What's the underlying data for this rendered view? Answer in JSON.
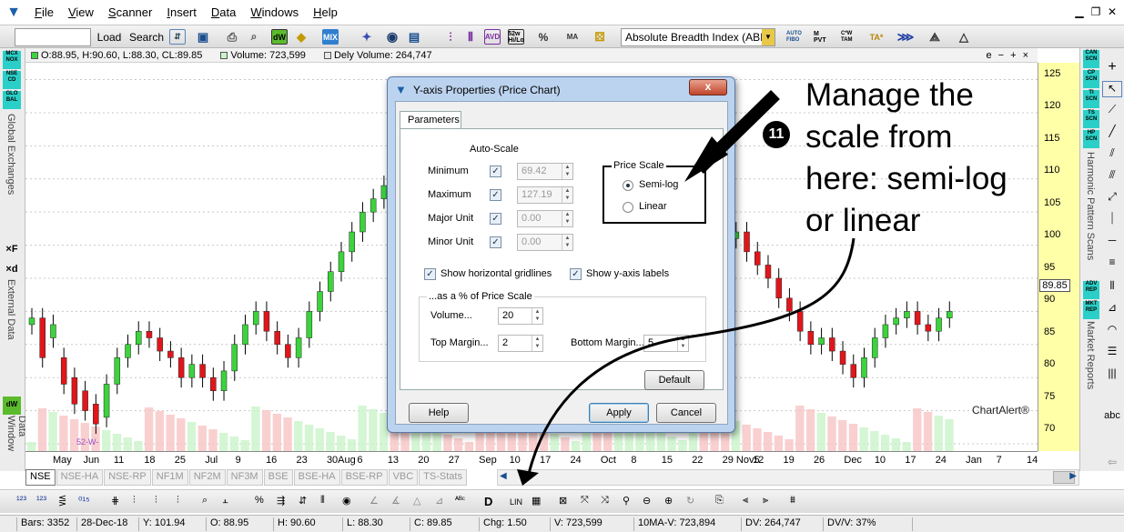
{
  "menu": {
    "items": [
      "File",
      "View",
      "Scanner",
      "Insert",
      "Data",
      "Windows",
      "Help"
    ]
  },
  "toolbar": {
    "load_label": "Load",
    "search_label": "Search",
    "indicator_value": "Absolute Breadth Index (ABI",
    "icon_labels": {
      "dw": "dW",
      "week52": "52w Hi/Lo",
      "mix": "MIX",
      "fibo": "AUTO FIBO",
      "mpvt": "M PVT",
      "tam": "C*W TAM",
      "ta": "TA*"
    }
  },
  "infobar": {
    "ohlc": "O:88.95, H:90.60, L:88.30, CL:89.85",
    "volume": "Volume: 723,599",
    "dely": "Dely Volume: 264,747",
    "corner": "e − + ×"
  },
  "left_panel": {
    "buttons": [
      "MCX NOX",
      "NSE CD",
      "GLO BAL"
    ],
    "global_label": "Global Exchanges",
    "xf_label": "×F",
    "xd_label": "×d",
    "external_label": "External Data",
    "dw": "dW",
    "data_window_label": "Data Window"
  },
  "right_panel": {
    "scan_buttons": [
      "CAN SCN",
      "CP SCN",
      "TI SCN",
      "TS SCN",
      "HP SCN"
    ],
    "harmonic_label": "Harmonic Pattern Scans",
    "report_buttons": [
      "ADV REP",
      "MKT REP"
    ],
    "market_reports_label": "Market Reports",
    "abc": "abc"
  },
  "yaxis": {
    "ticks": [
      "125",
      "120",
      "115",
      "110",
      "105",
      "100",
      "95",
      "90",
      "85",
      "80",
      "75",
      "70"
    ],
    "price_tag": "89.85"
  },
  "xaxis": {
    "labels": [
      "May",
      "Jun",
      "11",
      "18",
      "25",
      "Jul",
      "9",
      "16",
      "23",
      "30Aug",
      "6",
      "13",
      "20",
      "27",
      "Sep",
      "10",
      "17",
      "24",
      "Oct",
      "8",
      "15",
      "22",
      "29 Nov5",
      "12",
      "19",
      "26",
      "Dec",
      "10",
      "17",
      "24",
      "Jan",
      "7",
      "14"
    ]
  },
  "chart": {
    "watermark": "ChartAlert®",
    "low_label": "52-W-"
  },
  "chart_data": {
    "type": "candlestick",
    "ylim": [
      70,
      127
    ],
    "last": 89.85,
    "candles": [
      [
        88,
        89
      ],
      [
        89,
        83
      ],
      [
        86,
        88
      ],
      [
        83,
        79
      ],
      [
        80,
        76
      ],
      [
        78,
        75
      ],
      [
        76,
        73
      ],
      [
        74,
        79
      ],
      [
        79,
        83
      ],
      [
        83,
        85
      ],
      [
        85,
        87
      ],
      [
        87,
        86
      ],
      [
        86,
        84
      ],
      [
        84,
        83
      ],
      [
        83,
        80
      ],
      [
        80,
        82
      ],
      [
        82,
        80
      ],
      [
        80,
        78
      ],
      [
        78,
        81
      ],
      [
        81,
        85
      ],
      [
        85,
        88
      ],
      [
        88,
        90
      ],
      [
        90,
        87
      ],
      [
        87,
        85
      ],
      [
        85,
        83
      ],
      [
        83,
        86
      ],
      [
        86,
        90
      ],
      [
        90,
        93
      ],
      [
        93,
        96
      ],
      [
        96,
        99
      ],
      [
        99,
        102
      ],
      [
        102,
        105
      ],
      [
        105,
        107
      ],
      [
        107,
        109
      ],
      [
        109,
        106
      ],
      [
        106,
        104
      ],
      [
        104,
        105
      ],
      [
        105,
        107
      ],
      [
        107,
        108
      ],
      [
        108,
        106
      ],
      [
        106,
        105
      ],
      [
        105,
        104
      ],
      [
        104,
        103
      ],
      [
        103,
        101
      ],
      [
        101,
        100
      ],
      [
        100,
        99
      ],
      [
        99,
        97
      ],
      [
        97,
        95
      ],
      [
        95,
        93
      ],
      [
        93,
        94
      ],
      [
        94,
        92
      ],
      [
        92,
        94
      ],
      [
        94,
        95
      ],
      [
        95,
        93
      ],
      [
        93,
        91
      ],
      [
        91,
        92
      ],
      [
        92,
        94
      ],
      [
        94,
        96
      ],
      [
        96,
        98
      ],
      [
        98,
        100
      ],
      [
        100,
        102
      ],
      [
        102,
        104
      ],
      [
        104,
        106
      ],
      [
        106,
        105
      ],
      [
        105,
        103
      ],
      [
        103,
        101
      ],
      [
        101,
        102
      ],
      [
        102,
        99
      ],
      [
        99,
        97
      ],
      [
        97,
        95
      ],
      [
        95,
        92
      ],
      [
        92,
        90
      ],
      [
        90,
        87
      ],
      [
        87,
        85
      ],
      [
        85,
        86
      ],
      [
        86,
        84
      ],
      [
        84,
        82
      ],
      [
        82,
        80
      ],
      [
        80,
        83
      ],
      [
        83,
        86
      ],
      [
        86,
        88
      ],
      [
        88,
        89
      ],
      [
        89,
        90
      ],
      [
        90,
        88
      ],
      [
        88,
        87
      ],
      [
        87,
        89
      ],
      [
        89,
        90
      ]
    ]
  },
  "exchanges": {
    "tabs": [
      "NSE",
      "NSE-HA",
      "NSE-RP",
      "NF1M",
      "NF2M",
      "NF3M",
      "BSE",
      "BSE-HA",
      "BSE-RP",
      "VBC",
      "TS-Stats"
    ]
  },
  "toolbar2": {
    "lin": "LIN",
    "d": "D"
  },
  "status": {
    "bars": "Bars: 3352",
    "date": "28-Dec-18",
    "y": "Y: 101.94",
    "o": "O: 88.95",
    "h": "H: 90.60",
    "l": "L: 88.30",
    "c": "C: 89.85",
    "chg": "Chg: 1.50",
    "v": "V: 723,599",
    "ma": "10MA-V: 723,894",
    "dv": "DV: 264,747",
    "dvv": "DV/V: 37%"
  },
  "dialog": {
    "title": "Y-axis Properties (Price Chart)",
    "tab": "Parameters",
    "autoscale_label": "Auto-Scale",
    "minimum": {
      "label": "Minimum",
      "value": "69.42"
    },
    "maximum": {
      "label": "Maximum",
      "value": "127.19"
    },
    "major": {
      "label": "Major Unit",
      "value": "0.00"
    },
    "minor": {
      "label": "Minor Unit",
      "value": "0.00"
    },
    "price_scale_label": "Price Scale",
    "semilog_label": "Semi-log",
    "linear_label": "Linear",
    "hgrid_label": "Show horizontal gridlines",
    "ylabels_label": "Show y-axis labels",
    "pct_label": "...as a % of Price Scale",
    "volume": {
      "label": "Volume...",
      "value": "20"
    },
    "top_margin": {
      "label": "Top Margin...",
      "value": "2"
    },
    "bottom_margin": {
      "label": "Bottom Margin...",
      "value": "5"
    },
    "default_btn": "Default",
    "help_btn": "Help",
    "apply_btn": "Apply",
    "cancel_btn": "Cancel",
    "close": "x"
  },
  "annotation": {
    "number": "11",
    "lines": [
      "Manage the",
      "scale from",
      "here: semi-log",
      "or linear"
    ]
  }
}
